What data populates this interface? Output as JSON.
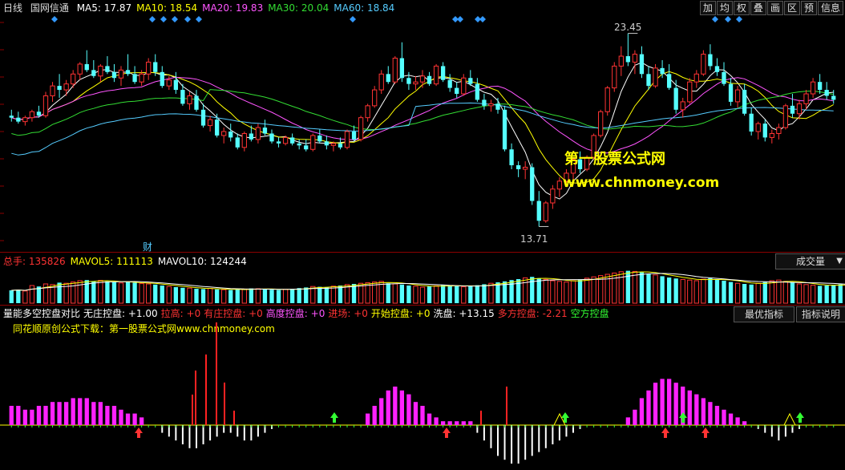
{
  "main_panel": {
    "period": "日线",
    "stock_name": "国网信通",
    "ma_items": [
      {
        "label": "MA5: 17.87",
        "color": "#ffffff"
      },
      {
        "label": "MA10: 18.54",
        "color": "#ffff00"
      },
      {
        "label": "MA20: 19.83",
        "color": "#ff55ff"
      },
      {
        "label": "MA30: 20.04",
        "color": "#33dd33"
      },
      {
        "label": "MA60: 18.84",
        "color": "#55ccff"
      }
    ],
    "toolbar": [
      "加",
      "均",
      "权",
      "叠",
      "画",
      "区",
      "预",
      "信息"
    ],
    "high_label": "23.45",
    "low_label": "13.71",
    "fin_mark": "财",
    "watermark_title": "第一股票公式网",
    "watermark_url": "www.chnmoney.com"
  },
  "volume_panel": {
    "items": [
      {
        "label": "总手: 135826",
        "color": "#ff3333"
      },
      {
        "label": "MAVOL5: 111113",
        "color": "#ffff00"
      },
      {
        "label": "MAVOL10: 124244",
        "color": "#ffffff"
      }
    ],
    "tab": "成交量"
  },
  "indicator_panel": {
    "items": [
      {
        "label": "量能多空控盘对比",
        "color": "#ffffff"
      },
      {
        "label": "无庄控盘: +1.00",
        "color": "#ffffff"
      },
      {
        "label": "拉高: +0",
        "color": "#ff3333"
      },
      {
        "label": "有庄控盘: +0",
        "color": "#ff3333"
      },
      {
        "label": "高度控盘: +0",
        "color": "#ff55ff"
      },
      {
        "label": "进场: +0",
        "color": "#ff3333"
      },
      {
        "label": "开始控盘: +0",
        "color": "#ffff00"
      },
      {
        "label": "洗盘: +13.15",
        "color": "#ffffff"
      },
      {
        "label": "多方控盘: -2.21",
        "color": "#ff3333"
      },
      {
        "label": "空方控盘",
        "color": "#33ff33"
      }
    ],
    "note": "同花顺原创公式下载：第一股票公式网www.chnmoney.com",
    "tab_optimal": "最优指标",
    "tab_help": "指标说明"
  },
  "chart_data": [
    {
      "type": "candlestick",
      "title": "国网信通 日线",
      "ylim": [
        13.0,
        24.0
      ],
      "ma_latest": {
        "MA5": 17.87,
        "MA10": 18.54,
        "MA20": 19.83,
        "MA30": 20.04,
        "MA60": 18.84
      },
      "high_marker": 23.45,
      "low_marker": 13.71,
      "candles": [
        [
          19.3,
          19.6,
          19.0,
          19.2
        ],
        [
          19.2,
          19.5,
          18.9,
          19.0
        ],
        [
          19.0,
          19.3,
          18.8,
          19.2
        ],
        [
          19.2,
          19.6,
          19.0,
          19.5
        ],
        [
          19.5,
          19.8,
          19.2,
          19.3
        ],
        [
          19.3,
          20.5,
          19.2,
          20.3
        ],
        [
          20.3,
          21.0,
          20.0,
          20.8
        ],
        [
          20.8,
          21.4,
          20.2,
          20.6
        ],
        [
          20.6,
          21.1,
          20.3,
          20.9
        ],
        [
          20.9,
          21.6,
          20.7,
          21.4
        ],
        [
          21.4,
          22.0,
          21.1,
          21.9
        ],
        [
          21.9,
          22.6,
          21.5,
          21.6
        ],
        [
          21.6,
          22.1,
          21.2,
          21.3
        ],
        [
          21.3,
          21.9,
          21.0,
          21.8
        ],
        [
          21.8,
          22.3,
          21.4,
          21.5
        ],
        [
          21.5,
          21.9,
          21.0,
          21.2
        ],
        [
          21.2,
          21.8,
          20.8,
          21.6
        ],
        [
          21.6,
          22.4,
          21.3,
          21.4
        ],
        [
          21.4,
          21.8,
          20.9,
          21.0
        ],
        [
          21.0,
          21.6,
          20.8,
          21.4
        ],
        [
          21.4,
          22.2,
          21.1,
          22.0
        ],
        [
          22.0,
          22.4,
          21.3,
          21.5
        ],
        [
          21.5,
          21.8,
          20.7,
          20.8
        ],
        [
          20.8,
          21.3,
          20.6,
          21.1
        ],
        [
          21.1,
          21.5,
          20.4,
          20.6
        ],
        [
          20.6,
          20.9,
          19.8,
          19.9
        ],
        [
          19.9,
          20.5,
          19.6,
          20.3
        ],
        [
          20.3,
          20.6,
          19.5,
          19.6
        ],
        [
          19.6,
          19.9,
          18.7,
          18.8
        ],
        [
          18.8,
          19.3,
          18.5,
          19.1
        ],
        [
          19.1,
          19.4,
          18.2,
          18.3
        ],
        [
          18.3,
          18.7,
          17.9,
          18.5
        ],
        [
          18.5,
          18.9,
          18.0,
          18.2
        ],
        [
          18.2,
          18.4,
          17.6,
          17.7
        ],
        [
          17.7,
          18.5,
          17.5,
          18.4
        ],
        [
          18.4,
          18.8,
          18.0,
          18.1
        ],
        [
          18.1,
          18.9,
          17.9,
          18.7
        ],
        [
          18.7,
          19.1,
          18.3,
          18.4
        ],
        [
          18.4,
          18.6,
          17.9,
          18.0
        ],
        [
          18.0,
          18.2,
          17.7,
          17.9
        ],
        [
          17.9,
          18.3,
          17.8,
          18.2
        ],
        [
          18.2,
          18.4,
          17.8,
          17.9
        ],
        [
          17.9,
          18.1,
          17.6,
          17.8
        ],
        [
          17.8,
          18.1,
          17.5,
          17.6
        ],
        [
          17.6,
          18.4,
          17.5,
          18.3
        ],
        [
          18.3,
          18.6,
          17.9,
          18.0
        ],
        [
          18.0,
          18.3,
          17.6,
          17.8
        ],
        [
          17.8,
          18.0,
          17.5,
          17.9
        ],
        [
          17.9,
          18.2,
          17.6,
          17.7
        ],
        [
          17.7,
          18.6,
          17.6,
          18.5
        ],
        [
          18.5,
          18.8,
          18.0,
          18.1
        ],
        [
          18.1,
          19.3,
          18.0,
          19.2
        ],
        [
          19.2,
          19.9,
          19.0,
          19.8
        ],
        [
          19.8,
          20.8,
          19.7,
          20.6
        ],
        [
          20.6,
          21.6,
          20.4,
          21.4
        ],
        [
          21.4,
          21.8,
          20.9,
          21.0
        ],
        [
          21.0,
          22.3,
          20.9,
          22.2
        ],
        [
          22.2,
          23.0,
          21.0,
          21.2
        ],
        [
          21.2,
          21.5,
          20.6,
          20.9
        ],
        [
          20.9,
          21.3,
          20.6,
          21.0
        ],
        [
          21.0,
          21.6,
          20.7,
          21.3
        ],
        [
          21.3,
          21.5,
          20.8,
          20.9
        ],
        [
          20.9,
          21.9,
          20.8,
          21.8
        ],
        [
          21.8,
          22.0,
          21.0,
          21.1
        ],
        [
          21.1,
          21.4,
          20.5,
          20.7
        ],
        [
          20.7,
          21.0,
          20.2,
          20.4
        ],
        [
          20.4,
          21.4,
          20.3,
          21.2
        ],
        [
          21.2,
          21.6,
          20.8,
          20.9
        ],
        [
          20.9,
          21.2,
          20.0,
          20.1
        ],
        [
          20.1,
          20.4,
          19.6,
          19.8
        ],
        [
          19.8,
          20.1,
          19.5,
          19.9
        ],
        [
          19.9,
          20.2,
          19.4,
          19.6
        ],
        [
          19.6,
          19.8,
          17.5,
          17.6
        ],
        [
          17.6,
          17.9,
          16.6,
          16.8
        ],
        [
          16.8,
          17.0,
          16.2,
          16.6
        ],
        [
          16.6,
          17.0,
          16.1,
          16.7
        ],
        [
          16.7,
          16.9,
          14.8,
          15.0
        ],
        [
          15.0,
          15.5,
          13.71,
          14.0
        ],
        [
          14.0,
          15.0,
          13.9,
          14.9
        ],
        [
          14.9,
          15.8,
          14.6,
          15.6
        ],
        [
          15.6,
          16.2,
          15.2,
          16.0
        ],
        [
          16.0,
          16.6,
          15.7,
          16.4
        ],
        [
          16.4,
          17.2,
          16.1,
          17.1
        ],
        [
          17.1,
          17.5,
          16.4,
          16.6
        ],
        [
          16.6,
          17.3,
          16.5,
          17.2
        ],
        [
          17.2,
          18.4,
          17.1,
          18.3
        ],
        [
          18.3,
          19.6,
          18.2,
          19.5
        ],
        [
          19.5,
          20.8,
          19.3,
          20.7
        ],
        [
          20.7,
          22.0,
          20.5,
          21.8
        ],
        [
          21.8,
          22.8,
          21.3,
          22.3
        ],
        [
          22.3,
          23.45,
          21.8,
          22.0
        ],
        [
          22.0,
          22.6,
          21.4,
          22.4
        ],
        [
          22.4,
          22.8,
          21.2,
          21.4
        ],
        [
          21.4,
          21.8,
          20.6,
          20.8
        ],
        [
          20.8,
          21.9,
          20.7,
          21.7
        ],
        [
          21.7,
          22.1,
          21.2,
          21.4
        ],
        [
          21.4,
          21.9,
          20.6,
          20.7
        ],
        [
          20.7,
          21.1,
          19.4,
          19.6
        ],
        [
          19.6,
          20.2,
          19.2,
          20.0
        ],
        [
          20.0,
          21.2,
          19.9,
          21.0
        ],
        [
          21.0,
          21.6,
          20.7,
          21.4
        ],
        [
          21.4,
          22.6,
          21.3,
          22.4
        ],
        [
          22.4,
          22.9,
          21.6,
          21.8
        ],
        [
          21.8,
          22.2,
          21.3,
          21.5
        ],
        [
          21.5,
          22.0,
          20.8,
          20.9
        ],
        [
          20.9,
          21.2,
          19.8,
          20.0
        ],
        [
          20.0,
          20.8,
          19.7,
          20.6
        ],
        [
          20.6,
          20.9,
          19.3,
          19.4
        ],
        [
          19.4,
          19.7,
          18.3,
          18.5
        ],
        [
          18.5,
          19.0,
          18.1,
          18.9
        ],
        [
          18.9,
          19.1,
          18.0,
          18.2
        ],
        [
          18.2,
          18.6,
          17.9,
          18.4
        ],
        [
          18.4,
          18.9,
          18.1,
          18.7
        ],
        [
          18.7,
          19.9,
          18.6,
          19.8
        ],
        [
          19.8,
          20.4,
          19.2,
          19.4
        ],
        [
          19.4,
          20.1,
          19.1,
          19.9
        ],
        [
          19.9,
          20.6,
          19.6,
          20.4
        ],
        [
          20.4,
          21.2,
          20.2,
          21.0
        ],
        [
          21.0,
          21.4,
          20.4,
          20.6
        ],
        [
          20.6,
          21.0,
          20.1,
          20.3
        ],
        [
          20.3,
          20.6,
          19.9,
          20.1
        ]
      ]
    },
    {
      "type": "bar",
      "title": "成交量",
      "series": [
        {
          "name": "总手",
          "values": [
            40,
            42,
            38,
            55,
            52,
            60,
            58,
            64,
            62,
            66,
            70,
            72,
            69,
            71,
            68,
            65,
            63,
            66,
            64,
            61,
            60,
            58,
            55,
            52,
            50,
            48,
            47,
            45,
            44,
            46,
            43,
            42,
            41,
            43,
            44,
            46,
            45,
            44,
            42,
            41,
            43,
            45,
            47,
            49,
            52,
            51,
            50,
            53,
            55,
            58,
            60,
            62,
            64,
            66,
            68,
            62,
            60,
            58,
            55,
            53,
            50,
            52,
            54,
            57,
            55,
            53,
            51,
            54,
            56,
            59,
            62,
            65,
            68,
            72,
            75,
            79,
            82,
            78,
            74,
            70,
            68,
            66,
            70,
            74,
            78,
            82,
            86,
            90,
            94,
            98,
            101,
            99,
            96,
            92,
            88,
            84,
            80,
            77,
            74,
            72,
            70,
            75,
            78,
            74,
            70,
            66,
            62,
            60,
            58,
            62,
            66,
            70,
            72,
            68,
            64,
            60,
            58,
            56,
            54,
            55,
            57,
            59,
            58
          ]
        }
      ]
    },
    {
      "type": "bar",
      "title": "量能多空控盘对比",
      "series": [
        {
          "name": "多方控盘",
          "values": [
            5,
            5,
            4,
            4,
            5,
            5,
            6,
            6,
            6,
            7,
            7,
            7,
            6,
            6,
            5,
            5,
            4,
            3,
            3,
            2,
            0,
            0,
            0,
            0,
            0,
            0,
            0,
            0,
            0,
            0,
            0,
            0,
            0,
            0,
            0,
            0,
            0,
            0,
            0,
            0,
            0,
            0,
            0,
            0,
            0,
            0,
            0,
            0,
            0,
            0,
            0,
            0,
            3,
            5,
            7,
            9,
            10,
            9,
            8,
            6,
            5,
            3,
            2,
            1,
            1,
            1,
            1,
            1,
            0,
            0,
            0,
            0,
            0,
            0,
            0,
            0,
            0,
            0,
            0,
            0,
            0,
            0,
            0,
            0,
            0,
            0,
            0,
            0,
            0,
            0,
            2,
            4,
            7,
            9,
            11,
            12,
            12,
            11,
            10,
            9,
            8,
            7,
            6,
            5,
            4,
            3,
            2,
            1,
            0,
            0,
            0,
            0,
            0,
            0,
            0,
            0,
            0,
            0,
            0,
            0,
            0,
            0
          ]
        },
        {
          "name": "空方控盘",
          "values": [
            0,
            0,
            0,
            0,
            0,
            0,
            0,
            0,
            0,
            0,
            0,
            0,
            0,
            0,
            0,
            0,
            0,
            0,
            0,
            0,
            0,
            0,
            -2,
            -3,
            -4,
            -5,
            -6,
            -6,
            -5,
            -4,
            -3,
            -2,
            -2,
            -3,
            -4,
            -4,
            -3,
            -2,
            -1,
            0,
            0,
            0,
            0,
            0,
            0,
            0,
            0,
            0,
            0,
            0,
            0,
            0,
            0,
            0,
            0,
            0,
            0,
            0,
            0,
            0,
            0,
            0,
            0,
            0,
            0,
            0,
            0,
            0,
            -2,
            -4,
            -6,
            -8,
            -9,
            -10,
            -10,
            -9,
            -8,
            -7,
            -6,
            -5,
            -4,
            -3,
            -2,
            -1,
            0,
            0,
            0,
            0,
            0,
            0,
            0,
            0,
            0,
            0,
            0,
            0,
            0,
            0,
            0,
            0,
            0,
            0,
            0,
            0,
            0,
            0,
            0,
            0,
            0,
            -1,
            -2,
            -3,
            -4,
            -3,
            -2,
            -1,
            0,
            0,
            0,
            0,
            0,
            0
          ]
        }
      ]
    }
  ]
}
